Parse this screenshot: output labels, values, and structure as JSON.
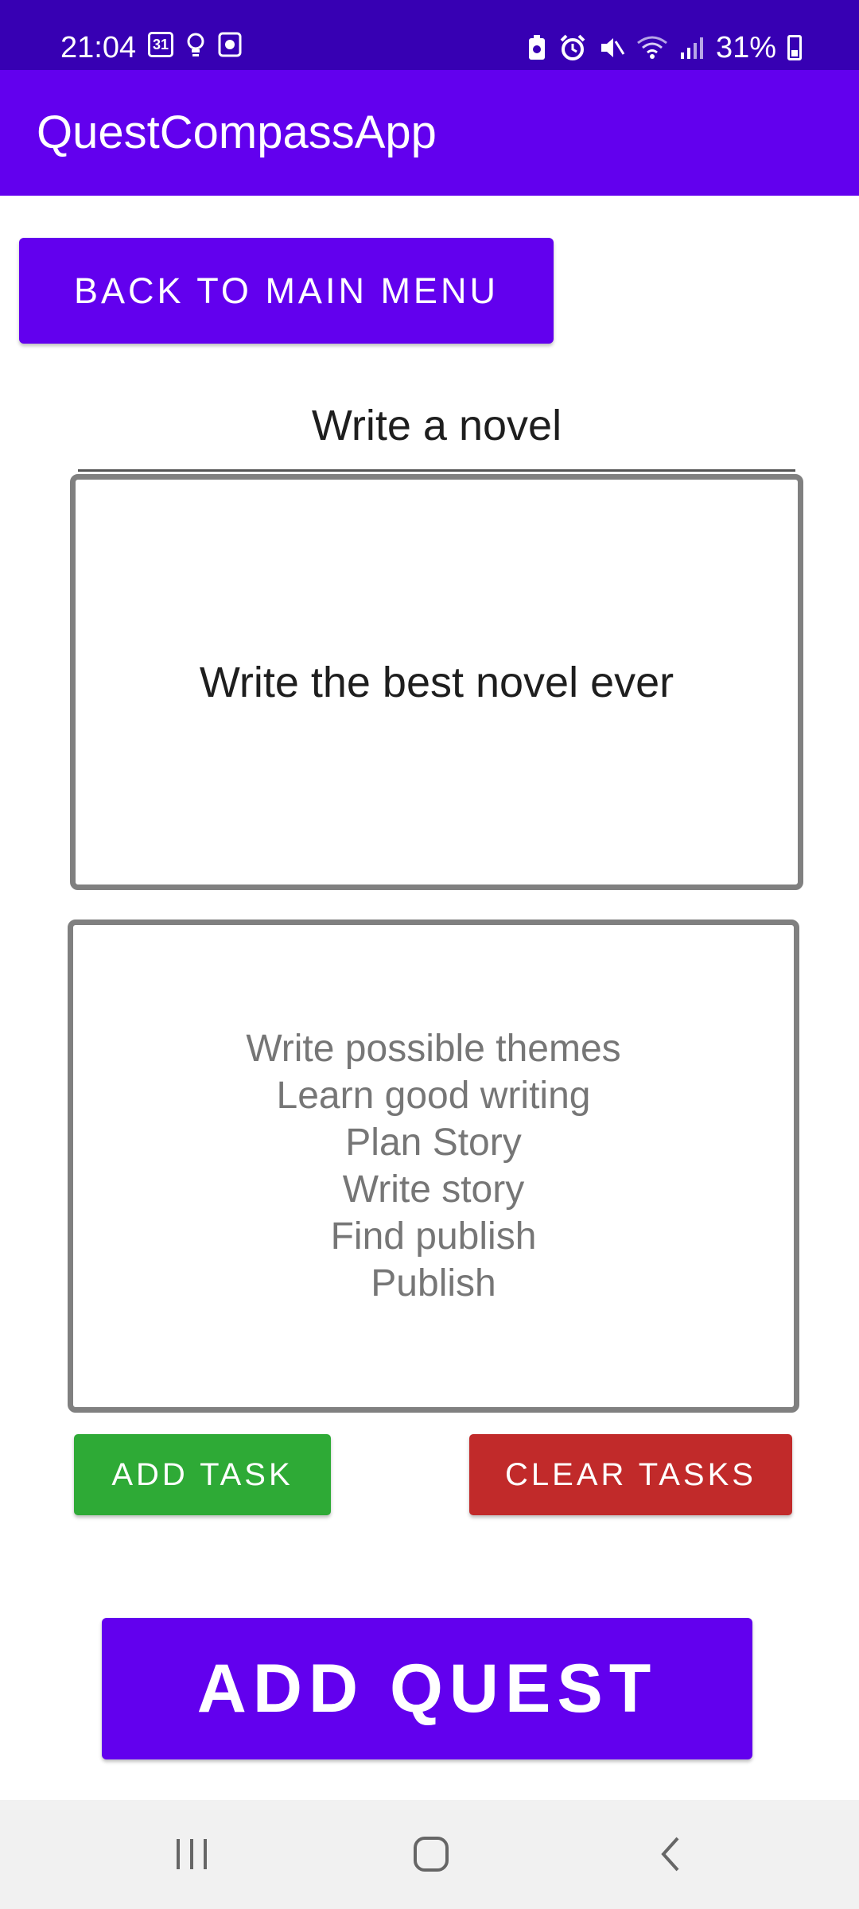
{
  "status_bar": {
    "time": "21:04",
    "calendar_badge": "31",
    "battery_percent": "31%"
  },
  "app_bar": {
    "title": "QuestCompassApp"
  },
  "buttons": {
    "back_to_main_menu": "BACK TO MAIN MENU",
    "add_task": "ADD TASK",
    "clear_tasks": "CLEAR TASKS",
    "add_quest": "ADD QUEST"
  },
  "quest": {
    "title": "Write a novel",
    "description": "Write the best novel ever",
    "tasks": [
      "Write possible themes",
      "Learn good writing",
      "Plan Story",
      "Write story",
      "Find publish",
      "Publish"
    ]
  },
  "colors": {
    "status_bar": "#3700b3",
    "primary": "#6200ee",
    "add_task": "#2eaa36",
    "clear_tasks": "#c12a2a",
    "nav_bar": "#f1f1f1"
  }
}
